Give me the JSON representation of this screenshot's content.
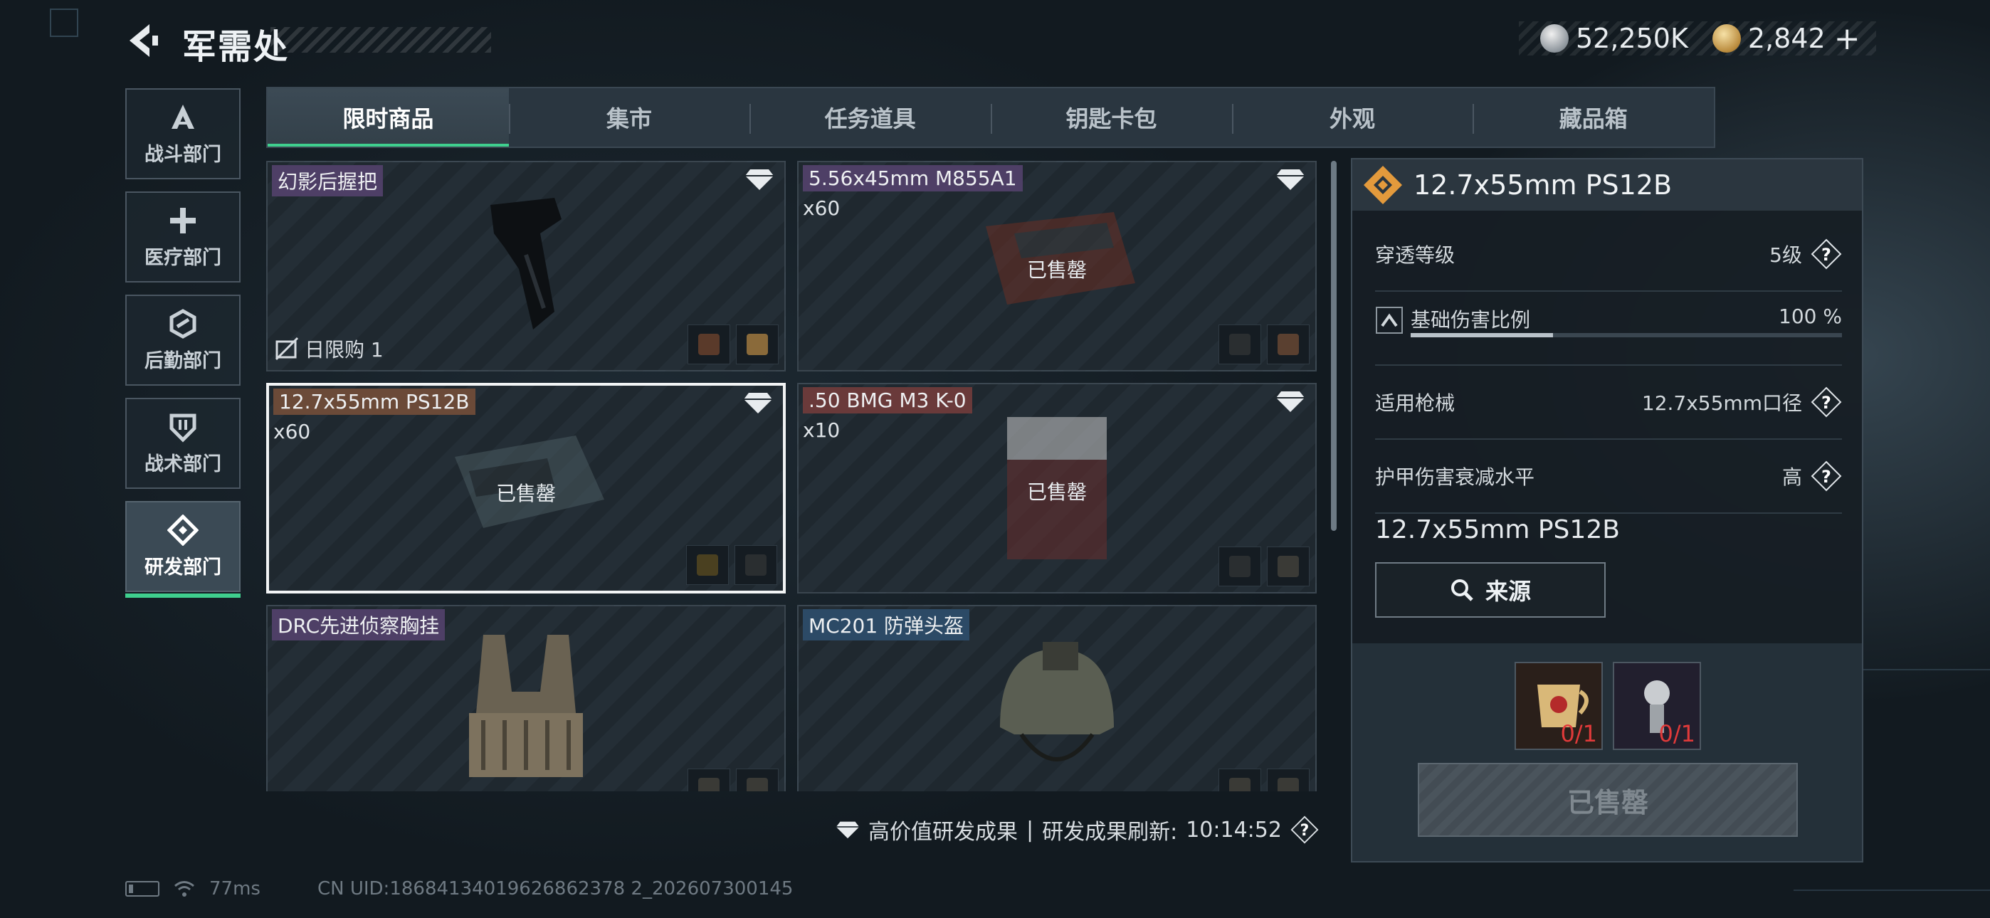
{
  "header": {
    "title": "军需处",
    "currency": {
      "silver": "52,250K",
      "gold": "2,842",
      "plus": "+"
    }
  },
  "sidebar": {
    "items": [
      {
        "label": "战斗部门",
        "icon": "combat-icon"
      },
      {
        "label": "医疗部门",
        "icon": "medical-cross-icon"
      },
      {
        "label": "后勤部门",
        "icon": "logistics-icon"
      },
      {
        "label": "战术部门",
        "icon": "tactical-shield-icon"
      },
      {
        "label": "研发部门",
        "icon": "research-icon",
        "active": true
      }
    ]
  },
  "tabs": [
    {
      "label": "限时商品",
      "active": true
    },
    {
      "label": "集市"
    },
    {
      "label": "任务道具"
    },
    {
      "label": "钥匙卡包"
    },
    {
      "label": "外观"
    },
    {
      "label": "藏品箱"
    }
  ],
  "items": [
    {
      "name": "幻影后握把",
      "tag_color": "purple",
      "limit": "日限购 1"
    },
    {
      "name": "5.56x45mm M855A1",
      "tag_color": "purple",
      "qty": "x60",
      "status": "已售罄"
    },
    {
      "name": "12.7x55mm PS12B",
      "tag_color": "orange",
      "qty": "x60",
      "status": "已售罄",
      "selected": true
    },
    {
      "name": ".50 BMG M3 K-0",
      "tag_color": "red",
      "qty": "x10",
      "status": "已售罄"
    },
    {
      "name": "DRC先进侦察胸挂",
      "tag_color": "purple"
    },
    {
      "name": "MC201 防弹头盔",
      "tag_color": "blue"
    }
  ],
  "footer": {
    "legend_text": "高价值研发成果",
    "separator": "|",
    "refresh_label": "研发成果刷新:",
    "refresh_time": "10:14:52"
  },
  "status_bar": {
    "ping": "77ms",
    "uid": "CN UID:18684134019626862378 2_202607300145"
  },
  "detail": {
    "title": "12.7x55mm PS12B",
    "stats": [
      {
        "label": "穿透等级",
        "value": "5级"
      },
      {
        "label": "基础伤害比例",
        "value": "100 %",
        "fraction": 0.33
      },
      {
        "label": "适用枪械",
        "value": "12.7x55mm口径"
      },
      {
        "label": "护甲伤害衰减水平",
        "value": "高"
      }
    ],
    "name": "12.7x55mm PS12B",
    "source_button": "来源",
    "materials": [
      {
        "count": "0/1",
        "icon": "trophy-cup-icon"
      },
      {
        "count": "0/1",
        "icon": "light-bulb-icon"
      }
    ],
    "buy_button": "已售罄"
  },
  "colors": {
    "accent": "#3fcf8e",
    "panel": "#243039",
    "shortage": "#e03a3a"
  }
}
